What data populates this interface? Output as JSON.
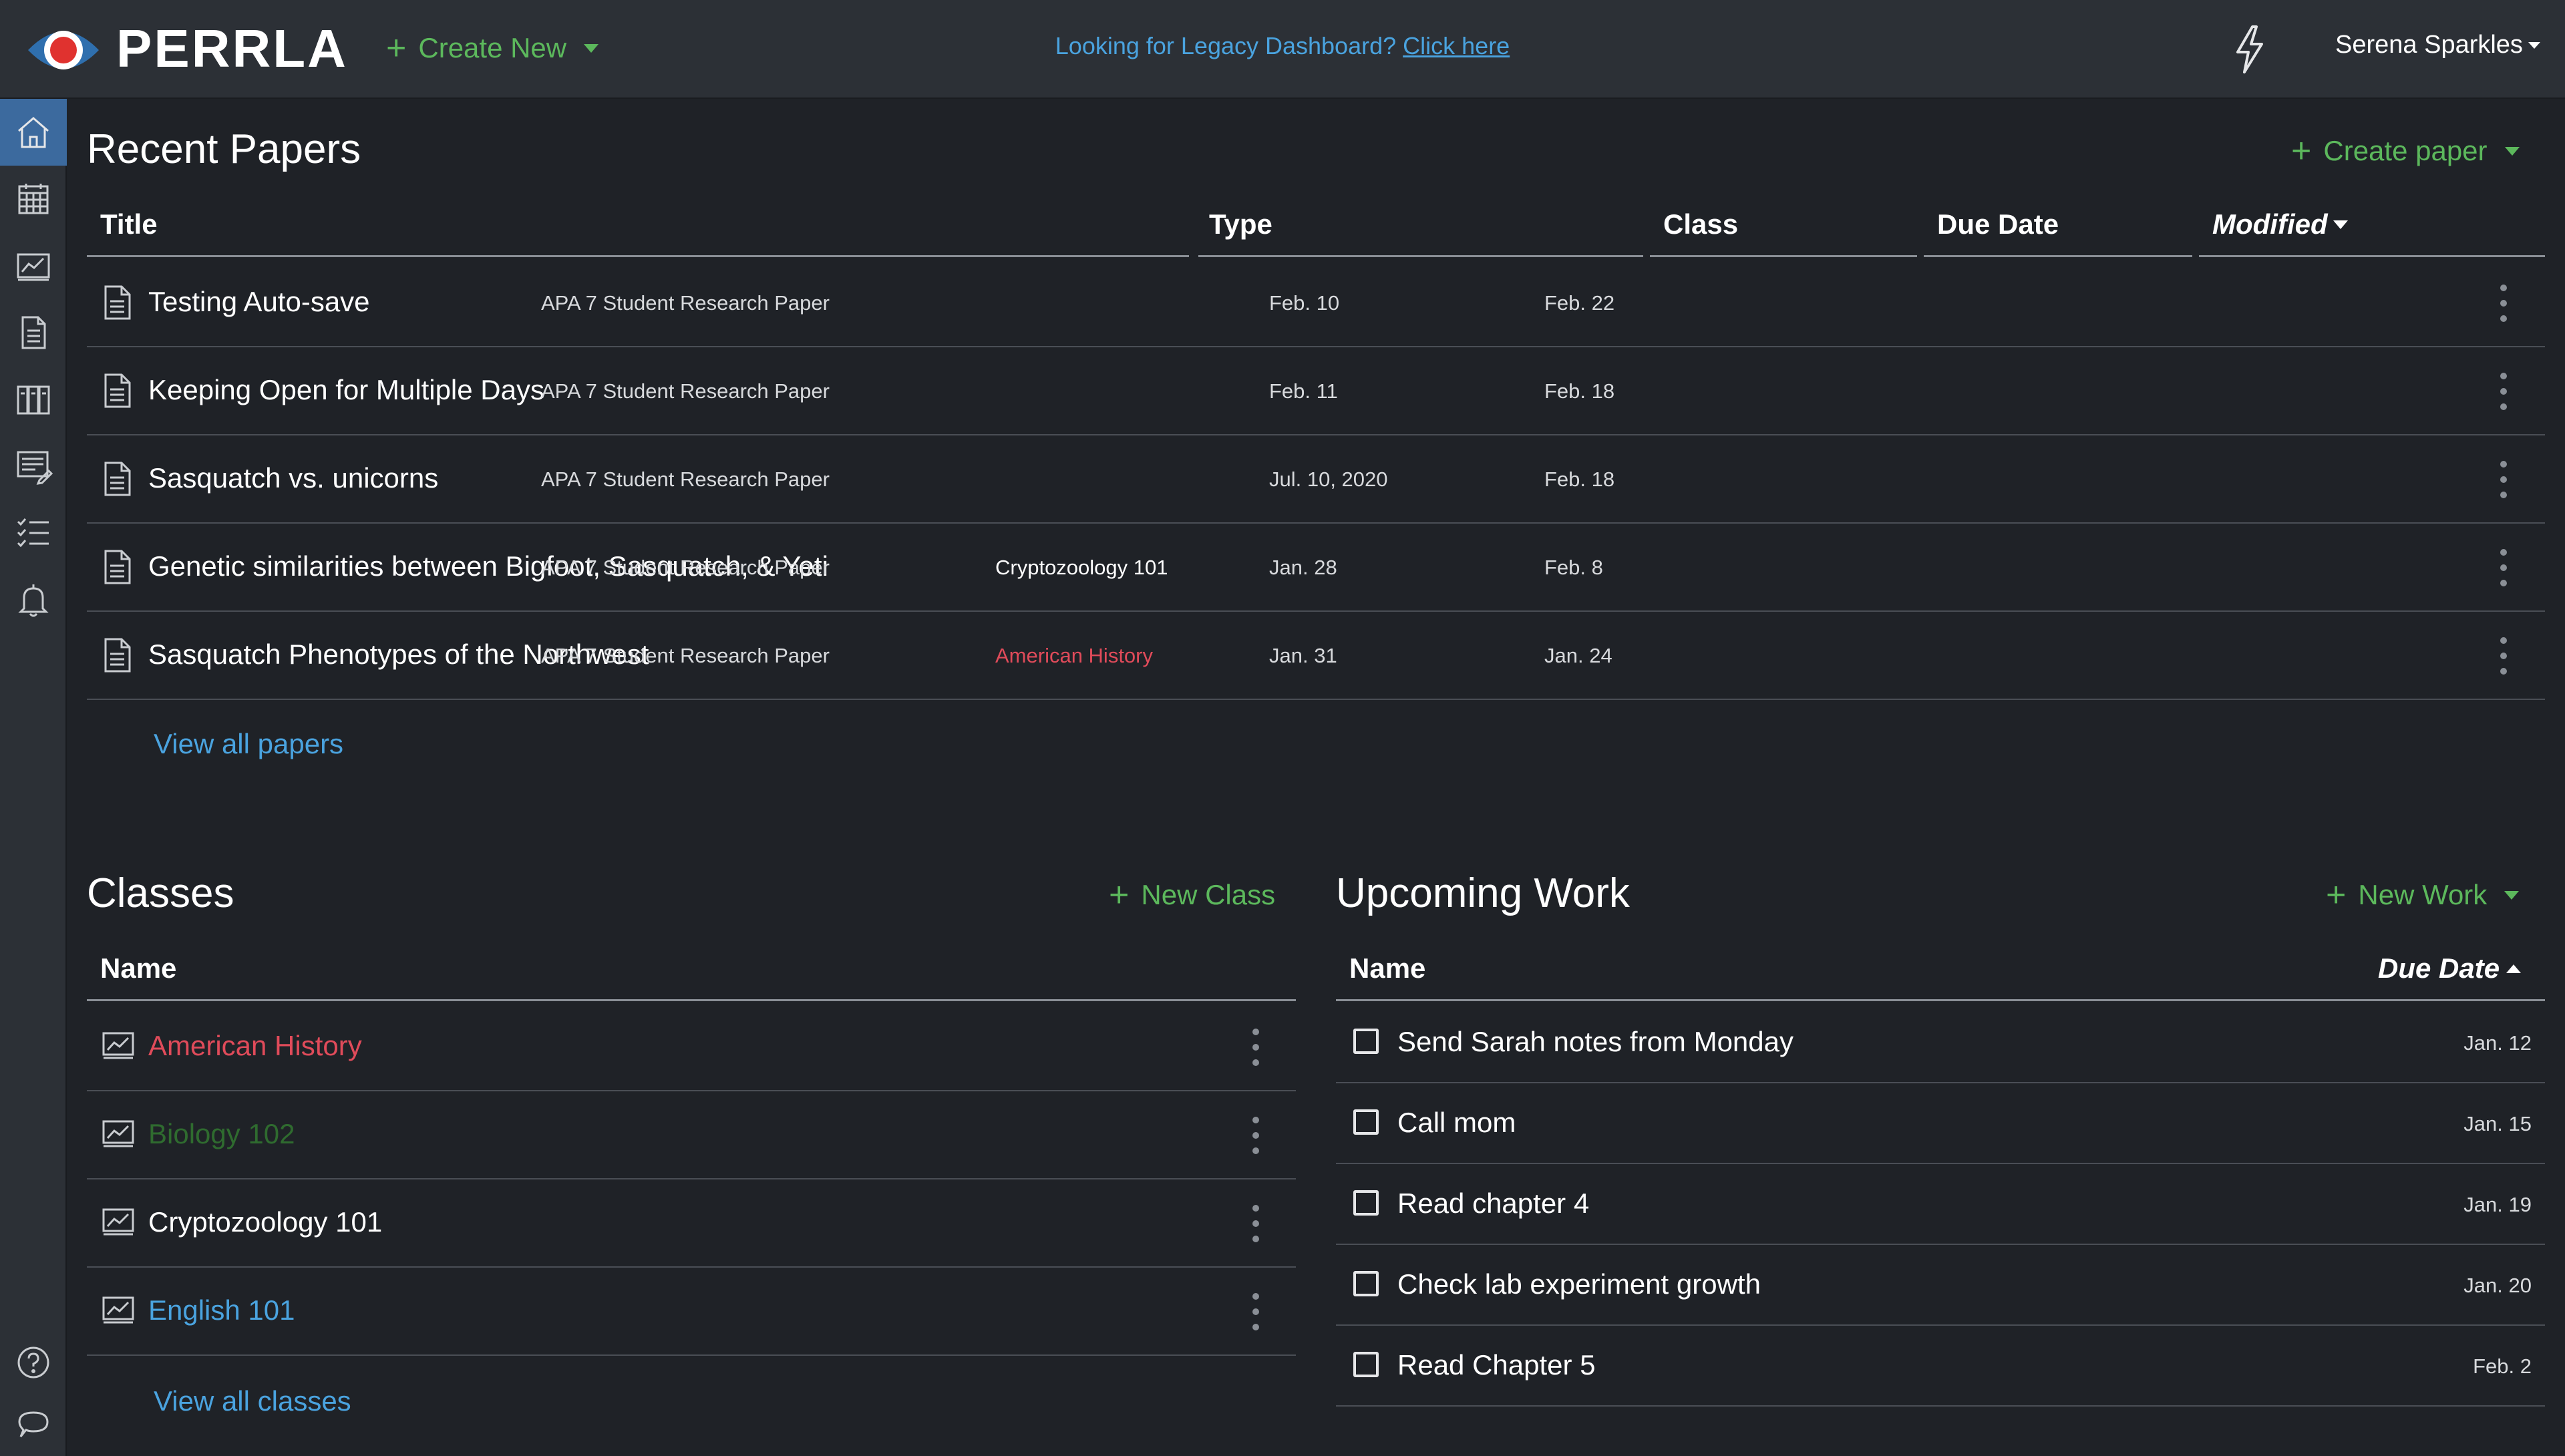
{
  "header": {
    "brand": "PERRLA",
    "create_new_label": "Create New",
    "legacy_text": "Looking for Legacy Dashboard?",
    "legacy_link": "Click here",
    "user_name": "Serena Sparkles"
  },
  "sidebar": {
    "items": [
      {
        "icon": "home-icon",
        "active": true
      },
      {
        "icon": "calendar-icon"
      },
      {
        "icon": "chart-icon"
      },
      {
        "icon": "document-icon"
      },
      {
        "icon": "library-icon"
      },
      {
        "icon": "notes-icon"
      },
      {
        "icon": "checklist-icon"
      },
      {
        "icon": "bell-icon"
      }
    ],
    "bottom_items": [
      {
        "icon": "help-icon"
      },
      {
        "icon": "chat-icon"
      }
    ]
  },
  "recent_papers": {
    "title": "Recent Papers",
    "create_label": "Create paper",
    "columns": {
      "title": "Title",
      "type": "Type",
      "class": "Class",
      "due_date": "Due Date",
      "modified": "Modified"
    },
    "rows": [
      {
        "title": "Testing Auto-save",
        "type": "APA 7 Student Research Paper",
        "class": "",
        "due": "Feb. 10",
        "modified": "Feb. 22"
      },
      {
        "title": "Keeping Open for Multiple Days",
        "type": "APA 7 Student Research Paper",
        "class": "",
        "due": "Feb. 11",
        "modified": "Feb. 18"
      },
      {
        "title": "Sasquatch vs. unicorns",
        "type": "APA 7 Student Research Paper",
        "class": "",
        "due": "Jul. 10, 2020",
        "modified": "Feb. 18"
      },
      {
        "title": "Genetic similarities between Bigfoot, Sasquatch, & Yeti",
        "type": "APA 7 Student Research Paper",
        "class": "Cryptozoology 101",
        "due": "Jan. 28",
        "modified": "Feb. 8"
      },
      {
        "title": "Sasquatch Phenotypes of the Northwest",
        "type": "APA 7 Student Research Paper",
        "class": "American History",
        "due": "Jan. 31",
        "modified": "Jan. 24"
      }
    ],
    "view_all": "View all papers"
  },
  "classes": {
    "title": "Classes",
    "new_label": "New Class",
    "column_name": "Name",
    "rows": [
      {
        "name": "American History",
        "color": "#e04b5a"
      },
      {
        "name": "Biology 102",
        "color": "#2f6b2f"
      },
      {
        "name": "Cryptozoology 101",
        "color": "#ffffff"
      },
      {
        "name": "English 101",
        "color": "#4aa3df"
      }
    ],
    "view_all": "View all classes"
  },
  "upcoming_work": {
    "title": "Upcoming Work",
    "new_label": "New Work",
    "column_name": "Name",
    "column_due": "Due Date",
    "rows": [
      {
        "name": "Send Sarah notes from Monday",
        "due": "Jan. 12"
      },
      {
        "name": "Call mom",
        "due": "Jan. 15"
      },
      {
        "name": "Read chapter 4",
        "due": "Jan. 19"
      },
      {
        "name": "Check lab experiment growth",
        "due": "Jan. 20"
      },
      {
        "name": "Read Chapter 5",
        "due": "Feb. 2"
      }
    ]
  },
  "colors": {
    "accent_green": "#5cb85c",
    "link_blue": "#4aa3df",
    "class_red": "#e04b5a"
  }
}
